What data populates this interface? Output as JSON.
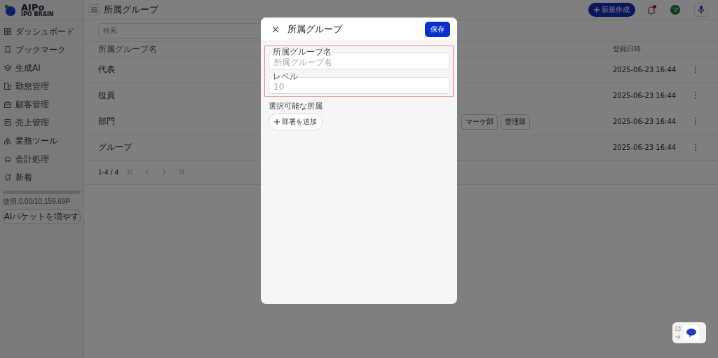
{
  "sidebar": {
    "logo": {
      "name": "AIPo",
      "subtitle": "IPO BRAIN"
    },
    "items": [
      {
        "label": "ダッシュボード"
      },
      {
        "label": "ブックマーク"
      },
      {
        "label": "生成AI"
      },
      {
        "label": "勤怠管理"
      },
      {
        "label": "顧客管理"
      },
      {
        "label": "売上管理"
      },
      {
        "label": "業務ツール"
      },
      {
        "label": "会計処理"
      },
      {
        "label": "新着"
      }
    ],
    "usage": {
      "level": 0.0,
      "text": "使用:0.00/10,159.69P"
    },
    "button": "AIパケットを増やす"
  },
  "header": {
    "title": "所属グループ",
    "new_button": "新規作成",
    "notification_dot": true,
    "avatar": "マ"
  },
  "search": {
    "placeholder": "検索"
  },
  "table": {
    "columns": [
      "所属グループ名",
      "登録日時"
    ],
    "rows": [
      {
        "name": "代表",
        "tags": [],
        "date": "2025-06-23 16:44"
      },
      {
        "name": "役員",
        "tags": [],
        "date": "2025-06-23 16:44"
      },
      {
        "name": "部門",
        "tags": [
          "マーケ部",
          "管理部"
        ],
        "date": "2025-06-23 16:44"
      },
      {
        "name": "グループ",
        "tags": [],
        "date": "2025-06-23 16:44"
      }
    ]
  },
  "pagination": {
    "range": "1-4 / 4"
  },
  "modal": {
    "title": "所属グループ",
    "save": "保存",
    "fields": [
      {
        "label": "所属グループ名",
        "placeholder": "所属グループ名"
      },
      {
        "label": "レベル",
        "placeholder": "10"
      }
    ],
    "section_label": "選択可能な所属",
    "add_button": "部署を追加"
  }
}
